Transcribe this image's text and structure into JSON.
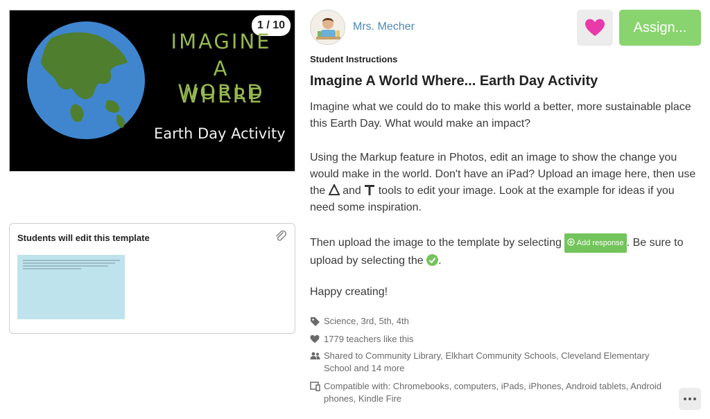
{
  "slide": {
    "counter": "1 / 10",
    "headline_lines": [
      "IMAGINE",
      "A WORLD",
      "WHERE"
    ],
    "subtitle": "Earth Day Activity"
  },
  "template_card": {
    "title": "Students will edit this template"
  },
  "teacher": {
    "name": "Mrs. Mecher"
  },
  "actions": {
    "assign_label": "Assign..."
  },
  "instructions": {
    "label": "Student Instructions",
    "title": "Imagine A World Where... Earth Day Activity",
    "para1": "Imagine what we could do to make this world a better, more sustainable place this Earth Day. What would make an impact?",
    "para2_start": "Using the Markup feature in Photos, edit an image to show the change you would make in the world. Don't have an iPad? Upload an image here, then use the ",
    "para2_and": " and ",
    "para2_end": " tools to edit your image. Look at the example for ideas if you need some inspiration.",
    "para3_start": "Then upload the image to the template by selecting ",
    "add_response_label": "Add response",
    "para3_mid": ". Be sure to upload by selecting the ",
    "para3_end": ".",
    "para4": "Happy creating!"
  },
  "meta": {
    "subjects": "Science, 3rd, 5th, 4th",
    "likes": "1779 teachers like this",
    "shared": "Shared to Community Library, Elkhart Community Schools, Cleveland Elementary School and 14 more",
    "compatible": "Compatible with: Chromebooks, computers, iPads, iPhones, Android tablets, Android phones, Kindle Fire"
  },
  "colors": {
    "accent_green": "#89d46f",
    "heart_pink": "#e83aa8",
    "teacher_blue": "#4c88b8",
    "slide_headline": "#96b84f"
  },
  "icons": [
    "paperclip-icon",
    "heart-icon",
    "tag-icon",
    "people-icon",
    "device-icon",
    "drawing-tool-icon",
    "text-tool-icon",
    "plus-circle-icon",
    "checkmark-icon",
    "more-icon"
  ]
}
